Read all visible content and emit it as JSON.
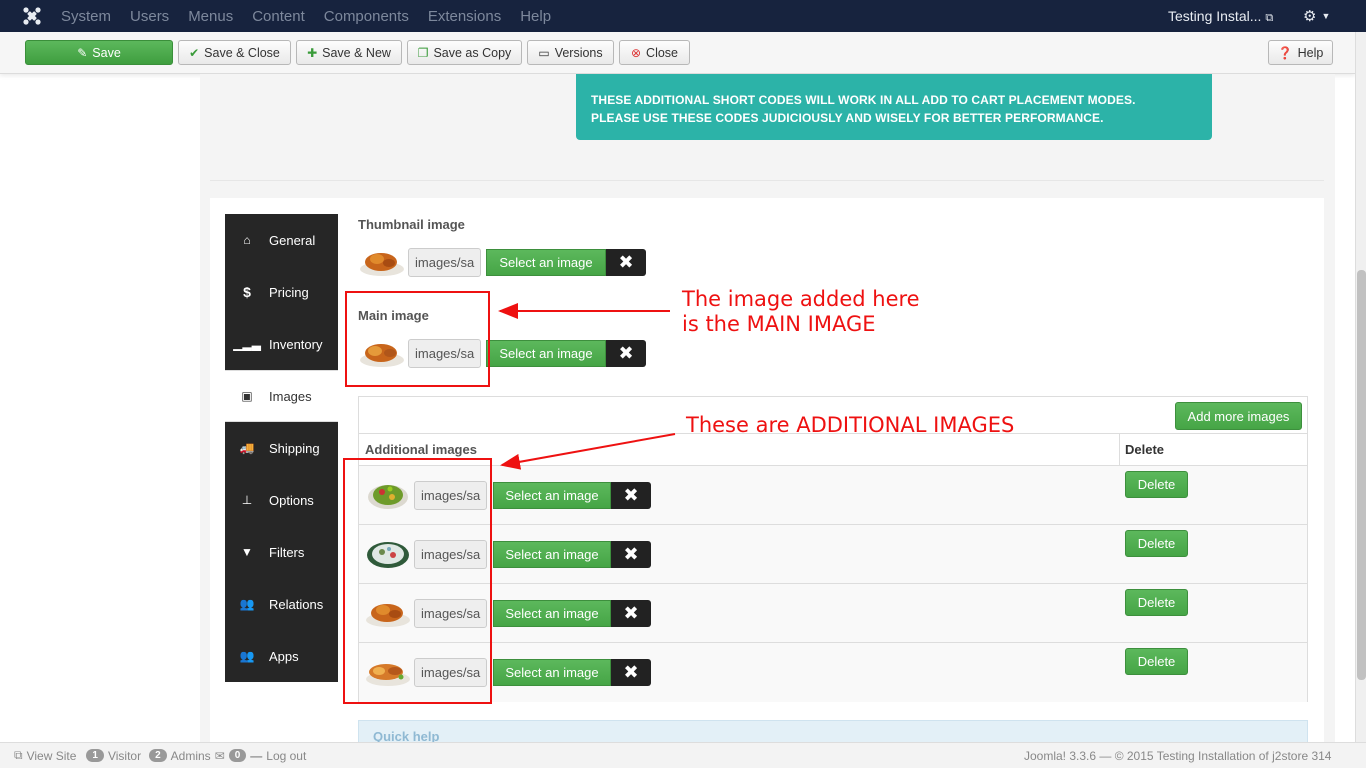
{
  "navbar": {
    "menu": [
      "System",
      "Users",
      "Menus",
      "Content",
      "Components",
      "Extensions",
      "Help"
    ],
    "site_name": "Testing Instal...",
    "settings_icon": "gear-icon"
  },
  "toolbar": {
    "save": "Save",
    "save_close": "Save & Close",
    "save_new": "Save & New",
    "save_copy": "Save as Copy",
    "versions": "Versions",
    "close": "Close",
    "help": "Help"
  },
  "info_box": {
    "line1": "THESE ADDITIONAL SHORT CODES WILL WORK IN ALL ADD TO CART PLACEMENT MODES.",
    "line2": "PLEASE USE THESE CODES JUDICIOUSLY AND WISELY FOR BETTER PERFORMANCE."
  },
  "tabs": [
    {
      "label": "General",
      "icon": "home-icon"
    },
    {
      "label": "Pricing",
      "icon": "dollar-icon"
    },
    {
      "label": "Inventory",
      "icon": "signal-icon"
    },
    {
      "label": "Images",
      "icon": "image-icon",
      "active": true
    },
    {
      "label": "Shipping",
      "icon": "truck-icon"
    },
    {
      "label": "Options",
      "icon": "sitemap-icon"
    },
    {
      "label": "Filters",
      "icon": "filter-icon"
    },
    {
      "label": "Relations",
      "icon": "users-icon"
    },
    {
      "label": "Apps",
      "icon": "users-icon"
    }
  ],
  "images": {
    "thumbnail_label": "Thumbnail image",
    "main_label": "Main image",
    "path_value": "images/sa",
    "select_label": "Select an image",
    "clear_glyph": "✖",
    "add_more": "Add more images",
    "additional_header": "Additional images",
    "delete_header": "Delete",
    "delete_label": "Delete",
    "rows": 4
  },
  "annotations": {
    "main_line1": "The image added here",
    "main_line2": "is the MAIN IMAGE",
    "additional": "These are ADDITIONAL IMAGES"
  },
  "quick_help": "Quick help",
  "status": {
    "view_site": "View Site",
    "visitor_count": "1",
    "visitor_label": "Visitor",
    "admin_count": "2",
    "admin_label": "Admins",
    "messages_count": "0",
    "logout": "Log out",
    "footer": "Joomla! 3.3.6 — © 2015 Testing Installation of j2store 314"
  },
  "colors": {
    "navbar": "#17233e",
    "success": "#5cb85c",
    "info": "#2cb3a8",
    "annotation": "#ee1111"
  }
}
